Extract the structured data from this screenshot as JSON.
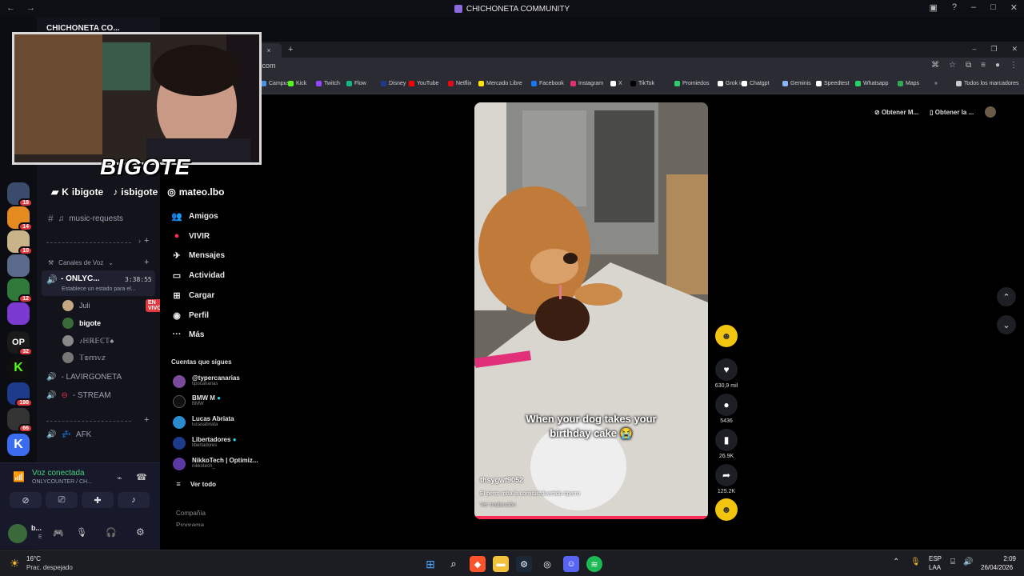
{
  "window": {
    "title": "CHICHONETA COMMUNITY"
  },
  "server_rail": {
    "badges": [
      "18",
      "14",
      "10",
      "12",
      "32",
      "198",
      "66"
    ],
    "k_letter": "K",
    "op_letter": "OP"
  },
  "channels": {
    "server_name": "CHICHONETA CO...",
    "music_requests": "music-requests",
    "voice_category": "Canales de Voz",
    "onlycounter": "- ONLYC...",
    "onlycounter_timer": "3:38:55",
    "onlycounter_status": "Establece un estado para el...",
    "members": [
      {
        "name": "Juli",
        "live": "EN VIVO"
      },
      {
        "name": "bigote",
        "live": ""
      },
      {
        "name": "♪ℍℝ𝔼ℂ𝕋♠",
        "live": ""
      },
      {
        "name": "𝕋𝕠𝕞𝕧𝕫",
        "live": ""
      }
    ],
    "lavirgoneta": "- LAVIRGONETA",
    "stream": "- STREAM",
    "afk": "AFK"
  },
  "voice_panel": {
    "title": "Voz conectada",
    "subtitle": "ONLYCOUNTER / CH...",
    "user_initial": "b...",
    "user_sub": "E"
  },
  "browser": {
    "tab_close": "×",
    "url": ".com",
    "bookmarks": [
      {
        "label": "Campus",
        "color": "#4a90e2"
      },
      {
        "label": "Kick",
        "color": "#53fc18"
      },
      {
        "label": "Twitch",
        "color": "#9146ff"
      },
      {
        "label": "Flow",
        "color": "#10b981"
      },
      {
        "label": "Disney",
        "color": "#1e3a8a"
      },
      {
        "label": "YouTube",
        "color": "#ff0000"
      },
      {
        "label": "Netflix",
        "color": "#e50914"
      },
      {
        "label": "Mercado Libre",
        "color": "#ffe600"
      },
      {
        "label": "Facebook",
        "color": "#1877f2"
      },
      {
        "label": "Instagram",
        "color": "#e1306c"
      },
      {
        "label": "X",
        "color": "#ffffff"
      },
      {
        "label": "TikTok",
        "color": "#000000"
      },
      {
        "label": "Promiedos",
        "color": "#2ecc71"
      },
      {
        "label": "Grok ia",
        "color": "#ffffff"
      },
      {
        "label": "Chatgpt",
        "color": "#ffffff"
      },
      {
        "label": "Geminis",
        "color": "#8ab4f8"
      },
      {
        "label": "Speedtest",
        "color": "#ffffff"
      },
      {
        "label": "Whatsapp",
        "color": "#25d366"
      },
      {
        "label": "Maps",
        "color": "#34a853"
      }
    ],
    "more": "»",
    "all_bookmarks": "Todos los marcadores"
  },
  "tiktok": {
    "nav": [
      {
        "label": "Amigos",
        "icon": "friends-icon"
      },
      {
        "label": "VIVIR",
        "icon": "live-icon"
      },
      {
        "label": "Mensajes",
        "icon": "messages-icon"
      },
      {
        "label": "Actividad",
        "icon": "activity-icon"
      },
      {
        "label": "Cargar",
        "icon": "upload-icon"
      },
      {
        "label": "Perfil",
        "icon": "profile-icon"
      },
      {
        "label": "Más",
        "icon": "more-icon"
      }
    ],
    "following_title": "Cuentas que sigues",
    "following": [
      {
        "name": "@typercanarias",
        "handle": "tipocanarias"
      },
      {
        "name": "BMW M",
        "handle": "BMW"
      },
      {
        "name": "Lucas Abriata",
        "handle": "lucasabriata"
      },
      {
        "name": "Libertadores",
        "handle": "libertadores"
      },
      {
        "name": "NikkoTech | Optimiz...",
        "handle": "nikkotech_"
      }
    ],
    "see_all": "Ver todo",
    "company": "Compañía",
    "program": "Programa",
    "top_buttons": [
      "Obtener M...",
      "Obtener la ..."
    ],
    "video": {
      "caption_line1": "When your dog takes your",
      "caption_line2": "birthday cake 😭",
      "author": "thsygwf9052",
      "description": "El perro roba la comida#divertido #perro",
      "translate": "Ver traducción"
    },
    "actions": {
      "likes": "630,9 mil",
      "comments": "5436",
      "saves": "26.9K",
      "shares": "125.2K"
    }
  },
  "webcam": {
    "brand": "BIGOTE",
    "twitch_kick": "ibigote",
    "tiktok": "isbigote",
    "instagram": "mateo.lbo"
  },
  "taskbar": {
    "temperature": "16°C",
    "weather": "Prac. despejado",
    "language": "ESP",
    "layout": "LAA",
    "time": "2:09",
    "date": "26/04/2026"
  }
}
